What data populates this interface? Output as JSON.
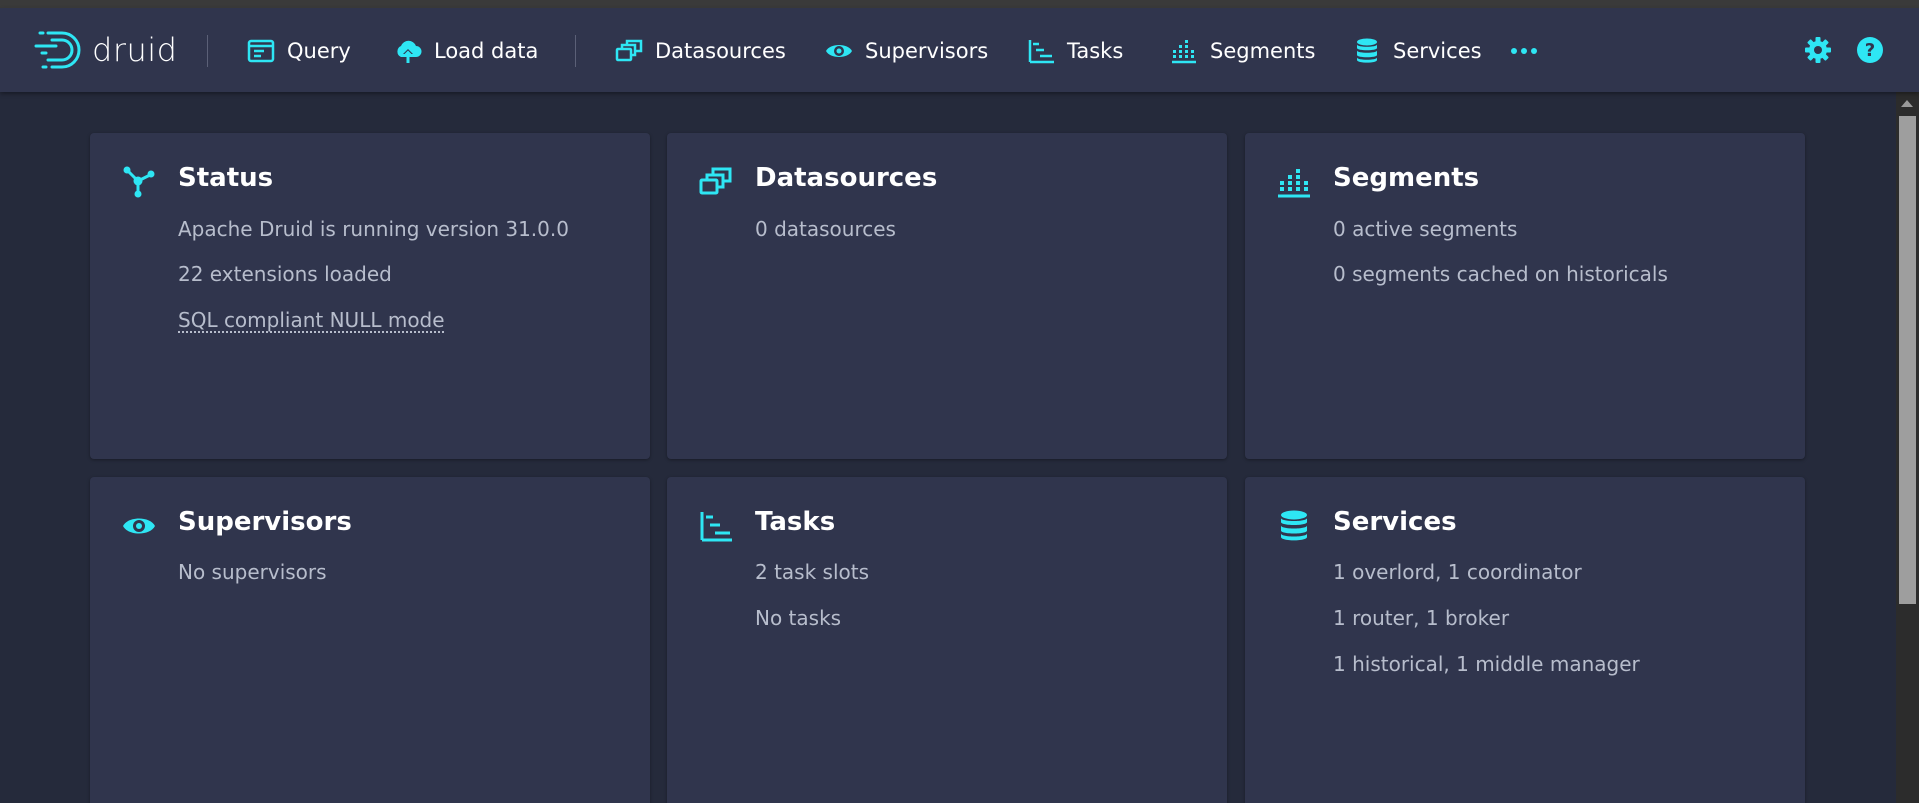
{
  "app": {
    "logo_text": "druid"
  },
  "nav": {
    "items": [
      {
        "label": "Query"
      },
      {
        "label": "Load data"
      },
      {
        "label": "Datasources"
      },
      {
        "label": "Supervisors"
      },
      {
        "label": "Tasks"
      },
      {
        "label": "Segments"
      },
      {
        "label": "Services"
      }
    ],
    "more_icon": "more-horizontal-icon",
    "settings_icon": "gear-icon",
    "help_icon": "help-icon"
  },
  "cards": {
    "status": {
      "title": "Status",
      "icon": "graph-icon",
      "lines": [
        "Apache Druid is running version 31.0.0",
        "22 extensions loaded",
        "SQL compliant NULL mode"
      ]
    },
    "datasources": {
      "title": "Datasources",
      "icon": "datasources-icon",
      "lines": [
        "0 datasources"
      ]
    },
    "segments": {
      "title": "Segments",
      "icon": "segments-icon",
      "lines": [
        "0 active segments",
        "0 segments cached on historicals"
      ]
    },
    "supervisors": {
      "title": "Supervisors",
      "icon": "eye-icon",
      "lines": [
        "No supervisors"
      ]
    },
    "tasks": {
      "title": "Tasks",
      "icon": "tasks-icon",
      "lines": [
        "2 task slots",
        "No tasks"
      ]
    },
    "services": {
      "title": "Services",
      "icon": "database-icon",
      "lines": [
        "1 overlord, 1 coordinator",
        "1 router, 1 broker",
        "1 historical, 1 middle manager"
      ]
    }
  },
  "colors": {
    "accent": "#2ee6f4",
    "navbar": "#30354d",
    "background": "#252a3b",
    "card": "#30354d",
    "text_primary": "#ffffff",
    "text_secondary": "#b7bdcc"
  }
}
